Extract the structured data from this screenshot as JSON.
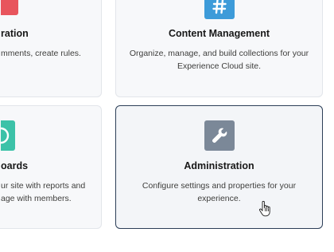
{
  "cards": [
    {
      "title": "ration",
      "desc_line1": "mments, create rules.",
      "icon": "partial-red-icon",
      "color": "#e8555d"
    },
    {
      "title": "Content Management",
      "desc_line1": "Organize, manage, and build collections for your",
      "desc_line2": "Experience Cloud site.",
      "icon": "hashtag-icon",
      "color": "#3d9bd9"
    },
    {
      "title": "oards",
      "desc_line1": "ur site with reports and",
      "desc_line2": "age with members.",
      "icon": "dashboard-icon",
      "color": "#3cc2a8"
    },
    {
      "title": "Administration",
      "desc_line1": "Configure settings and properties for your",
      "desc_line2": "experience.",
      "icon": "wrench-icon",
      "color": "#7b8898"
    }
  ],
  "cursor": "hand-pointer-icon"
}
